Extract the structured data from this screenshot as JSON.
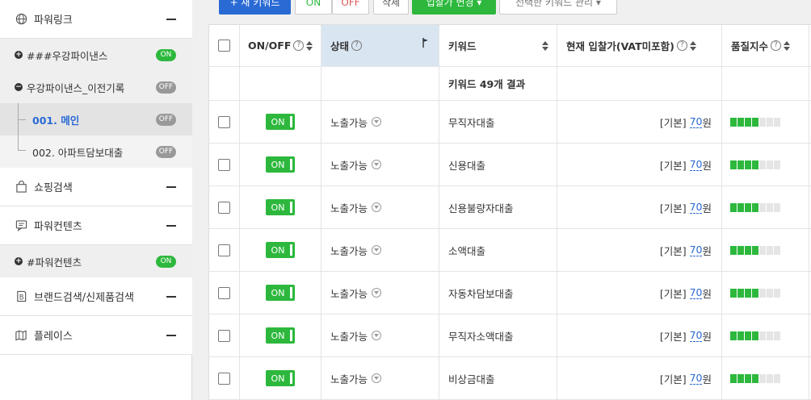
{
  "sidebar": {
    "sections": [
      {
        "label": "파워링크",
        "icon": "globe-icon"
      },
      {
        "label": "쇼핑검색",
        "icon": "shopping-bag-icon"
      },
      {
        "label": "파워컨텐츠",
        "icon": "chat-icon"
      },
      {
        "label": "브랜드검색/신제품검색",
        "icon": "brand-b-icon"
      },
      {
        "label": "플레이스",
        "icon": "map-icon"
      }
    ],
    "campaigns": [
      {
        "label": "###우강파이낸스",
        "status": "ON",
        "expanded": false
      },
      {
        "label": "우강파이낸스_이전기록",
        "status": "OFF",
        "expanded": true
      },
      {
        "label": "#파워컨텐츠",
        "status": "ON",
        "expanded": false
      }
    ],
    "adgroups": [
      {
        "label": "001. 메인",
        "status": "OFF",
        "active": true
      },
      {
        "label": "002. 아파트담보대출",
        "status": "OFF",
        "active": false
      }
    ]
  },
  "toolbar": {
    "new_keyword": "+ 새 키워드",
    "on": "ON",
    "off": "OFF",
    "delete": "삭제",
    "bid_change": "입찰가 변경 ▾",
    "manage": "선택한 키워드 관리 ▾"
  },
  "table": {
    "headers": {
      "onoff": "ON/OFF",
      "status": "상태",
      "keyword": "키워드",
      "bid": "현재 입찰가(VAT미포함)",
      "quality": "품질지수"
    },
    "summary": "키워드 49개 결과",
    "rows": [
      {
        "onoff": "ON",
        "status": "노출가능",
        "keyword": "무직자대출",
        "bid_prefix": "[기본]",
        "bid_value": "70",
        "bid_unit": "원",
        "quality": 4
      },
      {
        "onoff": "ON",
        "status": "노출가능",
        "keyword": "신용대출",
        "bid_prefix": "[기본]",
        "bid_value": "70",
        "bid_unit": "원",
        "quality": 4
      },
      {
        "onoff": "ON",
        "status": "노출가능",
        "keyword": "신용불량자대출",
        "bid_prefix": "[기본]",
        "bid_value": "70",
        "bid_unit": "원",
        "quality": 4
      },
      {
        "onoff": "ON",
        "status": "노출가능",
        "keyword": "소액대출",
        "bid_prefix": "[기본]",
        "bid_value": "70",
        "bid_unit": "원",
        "quality": 4
      },
      {
        "onoff": "ON",
        "status": "노출가능",
        "keyword": "자동차담보대출",
        "bid_prefix": "[기본]",
        "bid_value": "70",
        "bid_unit": "원",
        "quality": 4
      },
      {
        "onoff": "ON",
        "status": "노출가능",
        "keyword": "무직자소액대출",
        "bid_prefix": "[기본]",
        "bid_value": "70",
        "bid_unit": "원",
        "quality": 4
      },
      {
        "onoff": "ON",
        "status": "노출가능",
        "keyword": "비상금대출",
        "bid_prefix": "[기본]",
        "bid_value": "70",
        "bid_unit": "원",
        "quality": 4
      }
    ],
    "quality_max": 7
  },
  "colors": {
    "on_green": "#2db83d",
    "off_gray": "#999999",
    "active_blue": "#2a6ad4",
    "sorted_header_bg": "#d9e6f2"
  }
}
